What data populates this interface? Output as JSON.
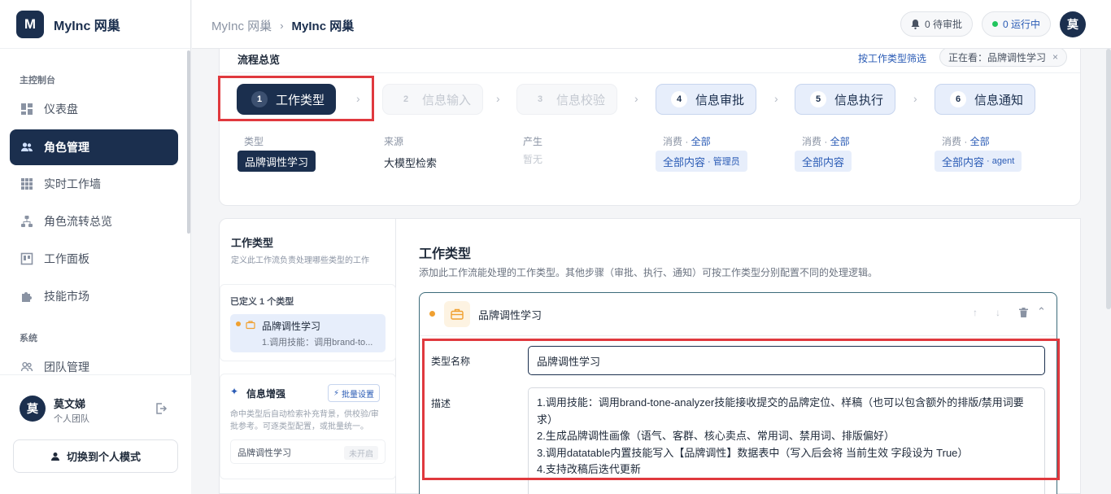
{
  "brand": {
    "logo_letter": "M",
    "name": "MyInc 网巢"
  },
  "sidebar": {
    "section_main": "主控制台",
    "section_system": "系统",
    "items": [
      {
        "label": "仪表盘",
        "icon": "dashboard-icon"
      },
      {
        "label": "角色管理",
        "icon": "users-icon"
      },
      {
        "label": "实时工作墙",
        "icon": "grid-icon"
      },
      {
        "label": "角色流转总览",
        "icon": "flow-icon"
      },
      {
        "label": "工作面板",
        "icon": "board-icon"
      },
      {
        "label": "技能市场",
        "icon": "puzzle-icon"
      },
      {
        "label": "团队管理",
        "icon": "team-icon"
      }
    ],
    "user": {
      "avatar": "莫",
      "name": "莫文娣",
      "team": "个人团队"
    },
    "switch_label": "切换到个人模式"
  },
  "topbar": {
    "breadcrumb_root": "MyInc 网巢",
    "breadcrumb_current": "MyInc 网巢",
    "pending_label": "0 待审批",
    "running_label": "0 运行中",
    "avatar": "莫"
  },
  "flow": {
    "title": "流程总览",
    "filter_link": "按工作类型筛选",
    "filter_chip": "正在看：品牌调性学习",
    "steps": [
      {
        "num": "1",
        "label": "工作类型",
        "state": "active"
      },
      {
        "num": "2",
        "label": "信息输入",
        "state": "disabled"
      },
      {
        "num": "3",
        "label": "信息校验",
        "state": "disabled"
      },
      {
        "num": "4",
        "label": "信息审批",
        "state": "blue"
      },
      {
        "num": "5",
        "label": "信息执行",
        "state": "blue"
      },
      {
        "num": "6",
        "label": "信息通知",
        "state": "blue"
      }
    ],
    "col1": {
      "label": "类型",
      "tag": "品牌调性学习"
    },
    "col2": {
      "label": "来源",
      "value": "大模型检索"
    },
    "col3": {
      "label": "产生",
      "value": "暂无"
    },
    "col4": {
      "label": "消费 · ",
      "link": "全部",
      "tag": "全部内容",
      "sub": "· 管理员"
    },
    "col5": {
      "label": "消费 · ",
      "link": "全部",
      "tag": "全部内容"
    },
    "col6": {
      "label": "消费 · ",
      "link": "全部",
      "tag": "全部内容",
      "sub": "· agent"
    }
  },
  "left_panel": {
    "title": "工作类型",
    "desc": "定义此工作流负责处理哪些类型的工作",
    "defined_label": "已定义 1 个类型",
    "type_name": "品牌调性学习",
    "type_sub": "1.调用技能：调用brand-to...",
    "enhance_title": "信息增强",
    "enhance_btn": "批量设置",
    "enhance_desc": "命中类型后自动检索补充背景，供校验/审批参考。可逐类型配置，或批量统一。",
    "enhance_item": "品牌调性学习",
    "enhance_status": "未开启"
  },
  "main_panel": {
    "title": "工作类型",
    "desc": "添加此工作流能处理的工作类型。其他步骤（审批、执行、通知）可按工作类型分别配置不同的处理逻辑。",
    "card_title": "品牌调性学习",
    "name_label": "类型名称",
    "name_value": "品牌调性学习",
    "desc_label": "描述",
    "desc_lines": [
      "1.调用技能：调用brand-tone-analyzer技能接收提交的品牌定位、样稿（也可以包含额外的排版/禁用词要求）",
      "2.生成品牌调性画像（语气、客群、核心卖点、常用词、禁用词、排版偏好）",
      "3.调用datatable内置技能写入【品牌调性】数据表中（写入后会将 当前生效 字段设为 True）",
      "4.支持改稿后迭代更新"
    ]
  },
  "colors": {
    "brand": "#1b2f4e",
    "accent_blue": "#2a5bb5",
    "highlight_red": "#e0393e",
    "orange": "#f0a030",
    "green": "#22c55e"
  }
}
